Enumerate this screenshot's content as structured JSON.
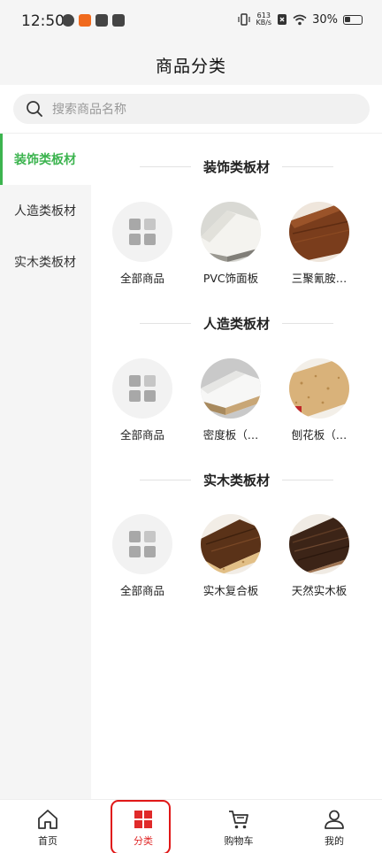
{
  "status_bar": {
    "time": "12:50",
    "net_speed_value": "613",
    "net_speed_unit": "KB/s",
    "battery": "30%"
  },
  "header": {
    "title": "商品分类"
  },
  "search": {
    "placeholder": "搜索商品名称",
    "icon": "search-icon"
  },
  "sidebar": {
    "items": [
      {
        "label": "装饰类板材",
        "active": true
      },
      {
        "label": "人造类板材",
        "active": false
      },
      {
        "label": "实木类板材",
        "active": false
      }
    ]
  },
  "sections": [
    {
      "title": "装饰类板材",
      "products": [
        {
          "label": "全部商品",
          "icon": "grid-icon"
        },
        {
          "label": "PVC饰面板",
          "icon": "pvc-panel-thumbnail"
        },
        {
          "label": "三聚氰胺…",
          "icon": "melamine-board-thumbnail"
        }
      ]
    },
    {
      "title": "人造类板材",
      "products": [
        {
          "label": "全部商品",
          "icon": "grid-icon"
        },
        {
          "label": "密度板（…",
          "icon": "density-board-thumbnail"
        },
        {
          "label": "刨花板（…",
          "icon": "particle-board-thumbnail"
        }
      ]
    },
    {
      "title": "实木类板材",
      "products": [
        {
          "label": "全部商品",
          "icon": "grid-icon"
        },
        {
          "label": "实木复合板",
          "icon": "composite-wood-thumbnail"
        },
        {
          "label": "天然实木板",
          "icon": "solid-wood-thumbnail"
        }
      ]
    }
  ],
  "tabbar": {
    "items": [
      {
        "label": "首页",
        "icon": "home-icon"
      },
      {
        "label": "分类",
        "icon": "category-icon",
        "active": true
      },
      {
        "label": "购物车",
        "icon": "cart-icon"
      },
      {
        "label": "我的",
        "icon": "user-icon"
      }
    ]
  },
  "colors": {
    "accent_green": "#3cb44f",
    "active_tab_red": "#e02a2a",
    "highlight_outline": "#e01818",
    "page_bg": "#f5f5f5"
  }
}
